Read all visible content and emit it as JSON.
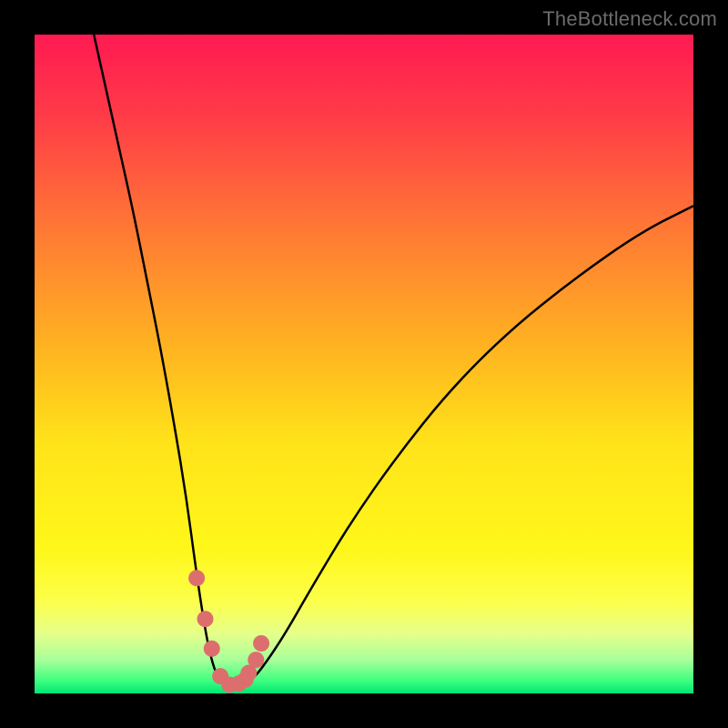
{
  "watermark": "TheBottleneck.com",
  "chart_data": {
    "type": "line",
    "title": "",
    "xlabel": "",
    "ylabel": "",
    "xlim": [
      0,
      100
    ],
    "ylim": [
      0,
      100
    ],
    "grid": false,
    "legend": false,
    "background_gradient_stops": [
      {
        "offset": 0,
        "color": "#ff1a52"
      },
      {
        "offset": 0.12,
        "color": "#ff3a48"
      },
      {
        "offset": 0.3,
        "color": "#ff7a34"
      },
      {
        "offset": 0.48,
        "color": "#ffb520"
      },
      {
        "offset": 0.62,
        "color": "#ffe31a"
      },
      {
        "offset": 0.78,
        "color": "#fff71a"
      },
      {
        "offset": 0.86,
        "color": "#fcff4a"
      },
      {
        "offset": 0.91,
        "color": "#e5ff8a"
      },
      {
        "offset": 0.95,
        "color": "#a6ff9a"
      },
      {
        "offset": 0.98,
        "color": "#3fff7f"
      },
      {
        "offset": 1.0,
        "color": "#00e676"
      }
    ],
    "series": [
      {
        "name": "bottleneck-curve",
        "stroke": "#000000",
        "stroke_width": 2.5,
        "x": [
          9,
          11,
          13,
          15,
          17,
          19,
          21,
          23,
          24.6,
          26,
          27,
          28,
          29,
          30,
          31,
          33,
          35,
          38,
          42,
          48,
          55,
          63,
          72,
          82,
          92,
          100
        ],
        "values": [
          100,
          91,
          82,
          73,
          63,
          53,
          42,
          30,
          18,
          9,
          4.5,
          2,
          1.2,
          1.1,
          1.3,
          2,
          4.5,
          9,
          16,
          26,
          36,
          46,
          55,
          63,
          70,
          74
        ]
      }
    ],
    "markers": [
      {
        "name": "sample-points",
        "fill": "#dd6e6e",
        "radius": 9,
        "x": [
          24.6,
          25.9,
          26.9,
          28.2,
          29.6,
          31.0,
          32.0,
          32.5,
          33.6,
          34.4
        ],
        "values": [
          17.5,
          11.3,
          6.8,
          2.6,
          1.3,
          1.5,
          2.1,
          3.1,
          5.1,
          7.6
        ]
      }
    ]
  }
}
